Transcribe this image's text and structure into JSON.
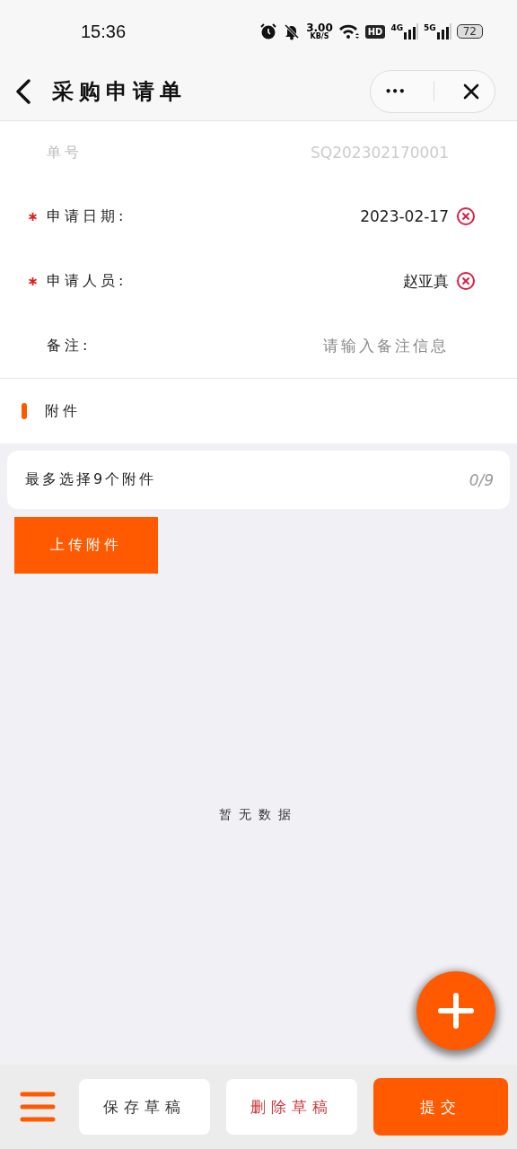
{
  "status_bar": {
    "time": "15:36",
    "net_speed": "3.00",
    "net_unit": "KB/S",
    "hd": "HD",
    "sim1": "4G",
    "sim2": "5G",
    "battery": "72"
  },
  "header": {
    "title": "采购申请单",
    "more": "•••"
  },
  "fields": [
    {
      "label": "单号",
      "value": "SQ202302170001",
      "required": false,
      "disabled": true,
      "clearable": false
    },
    {
      "label": "申请日期:",
      "value": "2023-02-17",
      "required": true,
      "disabled": false,
      "clearable": true
    },
    {
      "label": "申请人员:",
      "value": "赵亚真",
      "required": true,
      "disabled": false,
      "clearable": true
    },
    {
      "label": "备注:",
      "placeholder": "请输入备注信息",
      "required": false,
      "disabled": false,
      "clearable": false
    }
  ],
  "attachments": {
    "title": "附件",
    "hint": "最多选择9个附件",
    "count": "0/9",
    "upload": "上传附件",
    "empty": "暂无数据"
  },
  "bottom_bar": {
    "buttons": [
      {
        "label": "保存草稿",
        "kind": "plain"
      },
      {
        "label": "删除草稿",
        "kind": "danger"
      },
      {
        "label": "提交",
        "kind": "primary"
      }
    ]
  }
}
